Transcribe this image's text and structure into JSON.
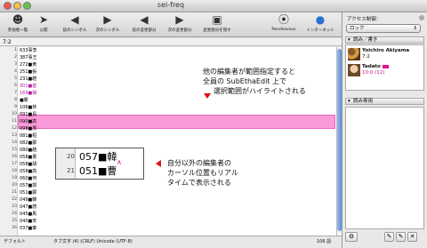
{
  "window": {
    "title": "sei-freq"
  },
  "toolbar": {
    "items": [
      {
        "label": "参加者一覧",
        "icon": "participants-icon"
      },
      {
        "label": "公開",
        "icon": "announce-icon"
      },
      {
        "label": "前のシンボル",
        "icon": "prev-symbol-icon"
      },
      {
        "label": "次のシンボル",
        "icon": "next-symbol-icon"
      },
      {
        "label": "前の変更部分",
        "icon": "prev-change-icon"
      },
      {
        "label": "次の変更部分",
        "icon": "next-change-icon"
      },
      {
        "label": "変更部分を隠す",
        "icon": "hide-changes-icon"
      },
      {
        "label": "Rendezvous",
        "icon": "rendezvous-icon"
      },
      {
        "label": "インターネット",
        "icon": "internet-icon"
      }
    ]
  },
  "position": "7:2",
  "editor": {
    "lines": [
      {
        "n": "1",
        "t": "633事李"
      },
      {
        "n": "2",
        "t": "387事王"
      },
      {
        "n": "3",
        "t": "272■黄"
      },
      {
        "n": "4",
        "t": "251■張"
      },
      {
        "n": "5",
        "t": "231■趙"
      },
      {
        "n": "6",
        "t": "301■崔"
      },
      {
        "n": "7",
        "t": "169■楊"
      },
      {
        "n": "8",
        "t": "■瞿"
      },
      {
        "n": "9",
        "t": "106■林"
      },
      {
        "n": "10",
        "t": "091■鳥"
      },
      {
        "n": "11",
        "t": "090■高"
      },
      {
        "n": "12",
        "t": "098■周"
      },
      {
        "n": "13",
        "t": "081■桓"
      },
      {
        "n": "14",
        "t": "082■鄭"
      },
      {
        "n": "15",
        "t": "080■趙"
      },
      {
        "n": "16",
        "t": "058■曹"
      },
      {
        "n": "17",
        "t": "058■胡"
      },
      {
        "n": "18",
        "t": "058■高"
      },
      {
        "n": "19",
        "t": "060■何"
      },
      {
        "n": "20",
        "t": "057■郭"
      },
      {
        "n": "21",
        "t": "051■鄭"
      },
      {
        "n": "22",
        "t": "049■韓"
      },
      {
        "n": "23",
        "t": "047■唐"
      },
      {
        "n": "24",
        "t": "045■馬"
      },
      {
        "n": "25",
        "t": "040■宋"
      },
      {
        "n": "26",
        "t": "037■秦"
      }
    ]
  },
  "callout1": {
    "lines": [
      "他の編集者が範囲指定すると",
      "全員の SubEthaEdit 上で",
      "選択範囲がハイライトされる"
    ]
  },
  "callout2": {
    "lines": [
      "自分以外の編集者の",
      "カーソル位置もリアル",
      "タイムで表示される"
    ]
  },
  "zoom": {
    "lines": [
      {
        "n": "20",
        "t": "057■韓"
      },
      {
        "n": "21",
        "t": "051■曹"
      }
    ]
  },
  "statusbar": {
    "mode": "デフォルト",
    "encoding": "タブ文字 (4)  (CRLF)  Unicode (UTF-8)",
    "size": "106 語"
  },
  "drawer": {
    "access_label": "アクセス制御：",
    "access_value": "ロック",
    "section_readwrite": "読み／書き",
    "users": [
      {
        "name": "Yoichiro Akiyama",
        "pos": "7:2"
      },
      {
        "name": "Tadato",
        "pos": "10:0 (12)"
      }
    ],
    "section_readonly": "読み専用"
  },
  "colors": {
    "selection": "#fb9ad9",
    "remote_user": "#e0128f",
    "arrow": "#e01010"
  }
}
